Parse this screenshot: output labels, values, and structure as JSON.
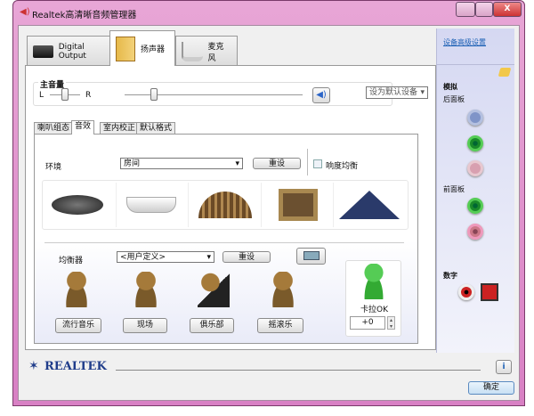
{
  "window": {
    "title": "Realtek高清晰音频管理器",
    "min": "—",
    "max": "□",
    "close": "X"
  },
  "device_tabs": [
    {
      "label": "Digital Output"
    },
    {
      "label": "扬声器"
    },
    {
      "label": "麦克风"
    }
  ],
  "master_volume": {
    "label": "主音量",
    "left": "L",
    "right": "R",
    "balance": 0.5,
    "volume": 0.2
  },
  "default_device": "设为默认设备",
  "sub_tabs": [
    "喇叭组态",
    "音效",
    "室内校正",
    "默认格式"
  ],
  "environment": {
    "label": "环境",
    "value": "房间",
    "reset": "重设",
    "loudness": "响度均衡",
    "loudness_checked": false
  },
  "equalizer": {
    "label": "均衡器",
    "value": "<用户定义>",
    "reset": "重设",
    "presets": [
      "流行音乐",
      "现场",
      "俱乐部",
      "摇滚乐"
    ]
  },
  "karaoke": {
    "label": "卡拉OK",
    "value": "+0"
  },
  "side": {
    "link": "设备高级设置",
    "analog": "模拟",
    "back_panel": "后面板",
    "front_panel": "前面板",
    "digital": "数字"
  },
  "brand": "REALTEK",
  "ok": "确定",
  "colors": {
    "accent": "#1a5fb4",
    "jack_blue": "#7f94c8",
    "jack_green": "#1a8a2a",
    "jack_pink": "#d8a0b0"
  }
}
